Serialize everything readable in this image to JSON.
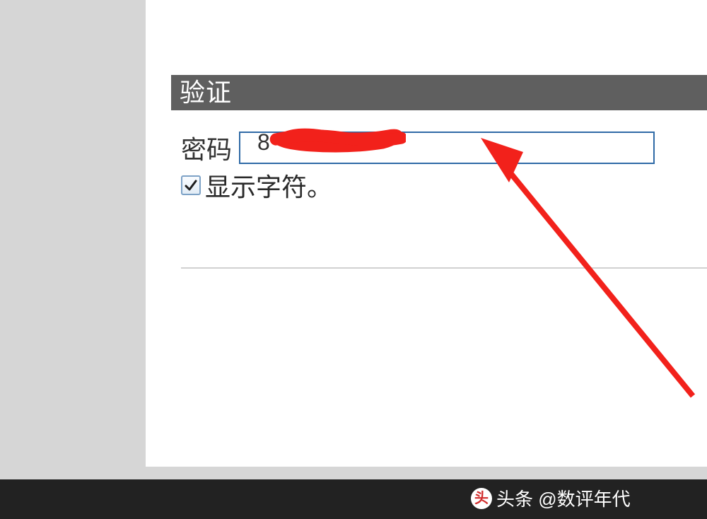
{
  "section": {
    "title": "验证"
  },
  "form": {
    "password_label": "密码",
    "password_visible_char": "8",
    "show_chars_label": "显示字符。",
    "show_chars_checked": true
  },
  "watermark": {
    "logo_glyph": "头",
    "text": "头条 @数评年代"
  },
  "colors": {
    "header_bg": "#5f5f5f",
    "input_border": "#2f6aa6",
    "arrow": "#f2211b",
    "redaction": "#f2211b"
  }
}
